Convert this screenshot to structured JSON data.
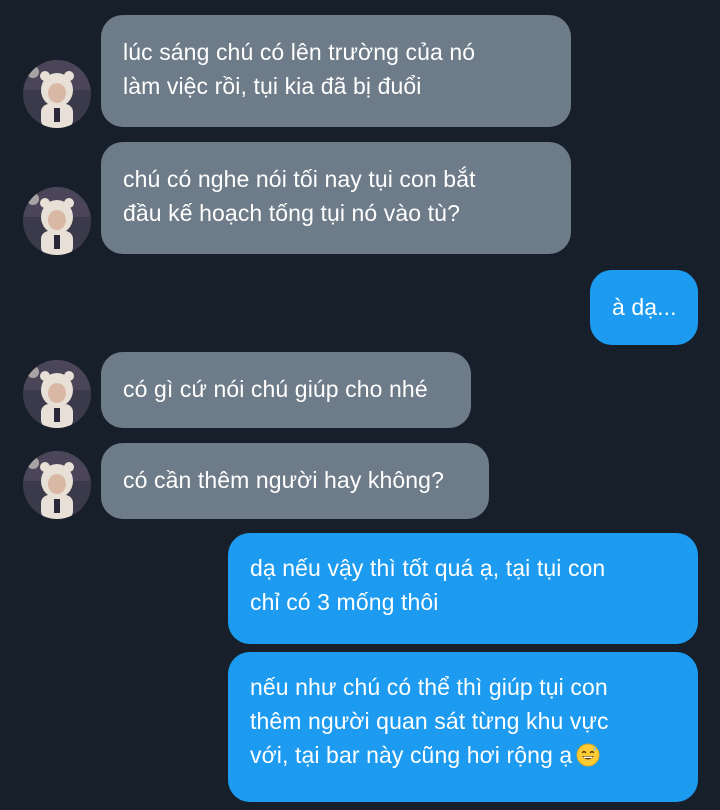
{
  "conversation": {
    "messages": [
      {
        "sender": "other",
        "lines": [
          "lúc sáng chú có lên trường của nó",
          "làm việc rồi, tụi kia đã bị đuổi"
        ]
      },
      {
        "sender": "other",
        "lines": [
          "chú có nghe nói tối nay tụi con bắt",
          "đầu kế hoạch tống tụi nó vào tù?"
        ]
      },
      {
        "sender": "me",
        "lines": [
          "à dạ..."
        ]
      },
      {
        "sender": "other",
        "lines": [
          "có gì cứ nói chú giúp cho nhé"
        ]
      },
      {
        "sender": "other",
        "lines": [
          "có cần thêm người hay không?"
        ]
      },
      {
        "sender": "me",
        "lines": [
          "dạ nếu vậy thì tốt quá ạ, tại tụi con",
          "chỉ có 3 mống thôi"
        ]
      },
      {
        "sender": "me",
        "lines": [
          "nếu như chú có thể thì giúp tụi con",
          "thêm người quan sát từng khu vực",
          "với, tại bar này cũng hơi rộng ạ"
        ],
        "emoji": "grinning-sweat-emoji"
      }
    ]
  },
  "colors": {
    "background": "#17202a",
    "incoming_bubble": "#6e7b88",
    "outgoing_bubble": "#1d9bf0",
    "text": "#ffffff"
  }
}
